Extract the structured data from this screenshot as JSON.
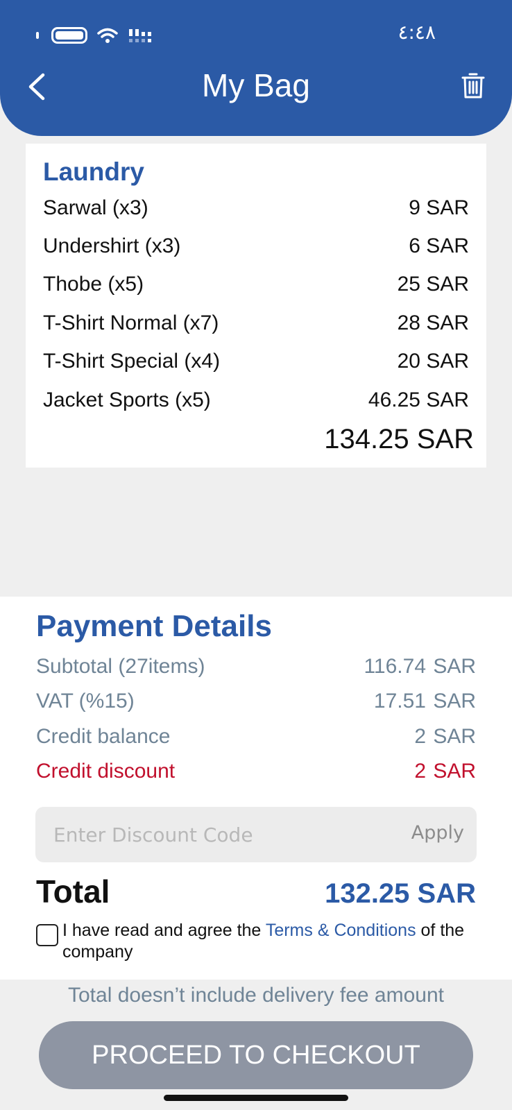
{
  "status_bar": {
    "time": "٤:٤٨"
  },
  "header": {
    "title": "My Bag"
  },
  "bag": {
    "section_title": "Laundry",
    "items": [
      {
        "name": "Sarwal (x3)",
        "price": "9 SAR"
      },
      {
        "name": "Undershirt (x3)",
        "price": "6 SAR"
      },
      {
        "name": "Thobe (x5)",
        "price": "25 SAR"
      },
      {
        "name": "T-Shirt Normal (x7)",
        "price": "28 SAR"
      },
      {
        "name": "T-Shirt Special (x4)",
        "price": "20 SAR"
      },
      {
        "name": "Jacket Sports (x5)",
        "price": "46.25 SAR"
      }
    ],
    "total": "134.25 SAR"
  },
  "payment": {
    "title": "Payment Details",
    "rows": [
      {
        "label": "Subtotal (27items)",
        "amount": "116.74",
        "currency": "SAR"
      },
      {
        "label": "VAT (%15)",
        "amount": "17.51",
        "currency": "SAR"
      },
      {
        "label": "Credit balance",
        "amount": "2",
        "currency": "SAR"
      },
      {
        "label": "Credit discount",
        "amount": "2",
        "currency": "SAR"
      }
    ],
    "discount_placeholder": "Enter Discount Code",
    "apply_label": "Apply",
    "total_label": "Total",
    "total_value": "132.25 SAR",
    "terms_prefix": "I have read and agree the ",
    "terms_link": "Terms & Conditions",
    "terms_suffix": " of the company"
  },
  "footer": {
    "note": "Total doesn’t include delivery fee amount",
    "checkout_label": "PROCEED TO CHECKOUT"
  },
  "colors": {
    "primary": "#2b5aa6",
    "muted": "#6f8496",
    "discount": "#c1102d",
    "checkout_button": "#8e95a3"
  }
}
